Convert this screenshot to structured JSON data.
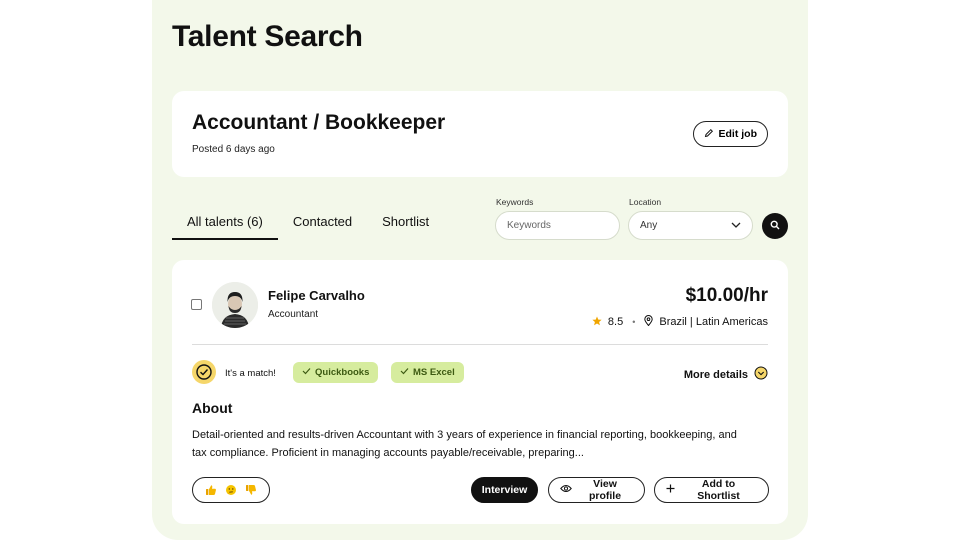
{
  "page": {
    "title": "Talent Search"
  },
  "job": {
    "title": "Accountant / Bookkeeper",
    "posted": "Posted 6 days ago",
    "edit_label": "Edit job"
  },
  "tabs": [
    {
      "label": "All talents (6)",
      "active": true
    },
    {
      "label": "Contacted",
      "active": false
    },
    {
      "label": "Shortlist",
      "active": false
    }
  ],
  "filters": {
    "keywords_label": "Keywords",
    "keywords_placeholder": "Keywords",
    "keywords_value": "",
    "location_label": "Location",
    "location_value": "Any"
  },
  "candidate": {
    "name": "Felipe Carvalho",
    "role": "Accountant",
    "rate": "$10.00/hr",
    "rating": "8.5",
    "location": "Brazil | Latin Americas",
    "match_text": "It's a match!",
    "skills": [
      "Quickbooks",
      "MS Excel"
    ],
    "more_details_label": "More details",
    "about_heading": "About",
    "about_text": "Detail-oriented and results-driven Accountant with 3 years of experience in financial reporting, bookkeeping, and tax compliance. Proficient in managing accounts payable/receivable, preparing...",
    "actions": {
      "interview": "Interview",
      "view_profile": "View profile",
      "add_shortlist": "Add to Shortlist"
    }
  },
  "colors": {
    "panel_bg": "#f3f8ea",
    "skill_tag_bg": "#d6ec9e",
    "match_badge": "#f5d66a",
    "star": "#f0a500"
  },
  "icons": [
    "pencil-icon",
    "search-icon",
    "chevron-down-icon",
    "star-icon",
    "location-pin-icon",
    "check-circle-icon",
    "check-icon",
    "chevron-circle-icon",
    "thumbs-up-icon",
    "thinking-face-icon",
    "thumbs-down-icon",
    "eye-icon",
    "plus-icon"
  ]
}
